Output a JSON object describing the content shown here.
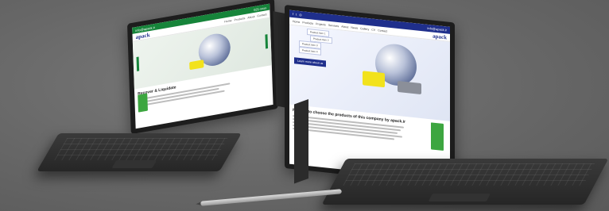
{
  "left_site": {
    "logo": "apack",
    "topbar_left": "info@apack.ir",
    "topbar_right": "021-xxxx",
    "menu": [
      "Home",
      "Products",
      "About",
      "Contact"
    ],
    "heading": "Recover & Liquidate"
  },
  "right_site": {
    "logo": "apack",
    "topbar_contact": "info@apack.ir",
    "menu": [
      "Home",
      "Products",
      "Projects",
      "Services",
      "About",
      "News",
      "Gallery",
      "CV",
      "Contact"
    ],
    "dropdowns": [
      "Product Item 1",
      "Product Item 2",
      "Product Item 3",
      "Product Item 4"
    ],
    "cta_label": "Learn more about us",
    "heading": "Reason to choose the products of this company by apack.ir"
  },
  "colors": {
    "left_brand": "#16843a",
    "right_brand": "#1f2f8c",
    "truck": "#f2e21c",
    "forklift": "#3da640"
  }
}
